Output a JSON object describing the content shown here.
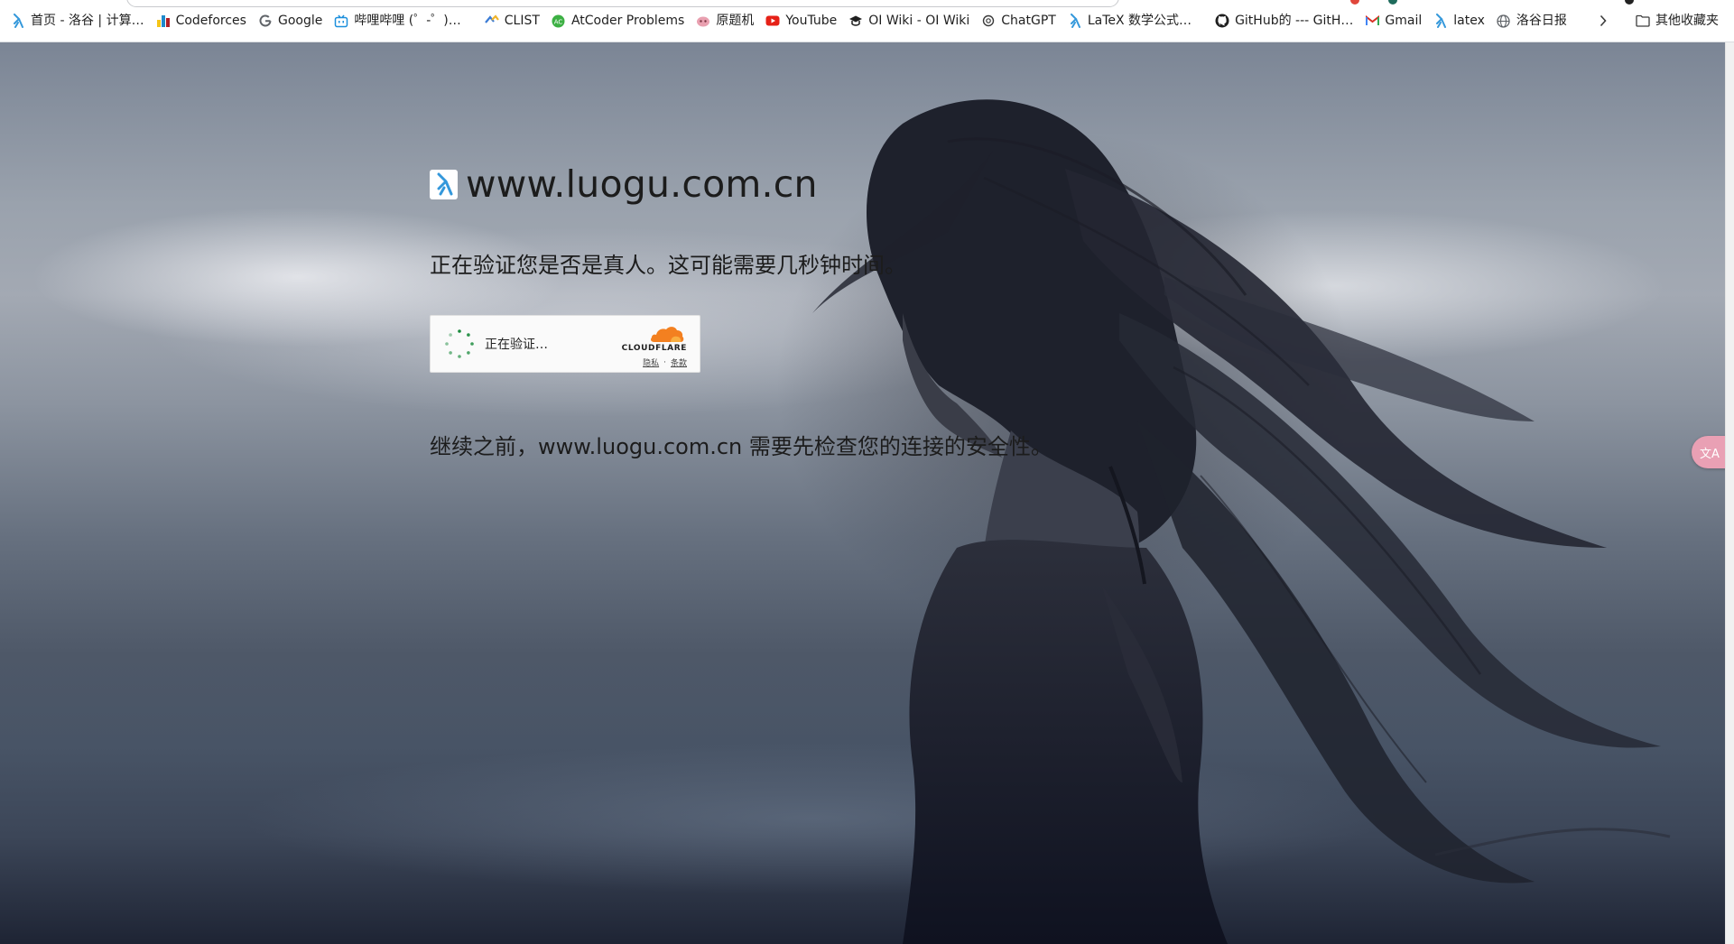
{
  "bookmarks_bar": {
    "items": [
      {
        "label": "首页 - 洛谷 | 计算…",
        "icon": "luogu-icon"
      },
      {
        "label": "Codeforces",
        "icon": "codeforces-icon"
      },
      {
        "label": "Google",
        "icon": "google-icon"
      },
      {
        "label": "哔哩哔哩 (゜-゜)…",
        "icon": "bilibili-icon"
      },
      {
        "label": "CLIST",
        "icon": "clist-icon"
      },
      {
        "label": "AtCoder Problems",
        "icon": "atcoder-icon"
      },
      {
        "label": "原题机",
        "icon": "yuantiji-icon"
      },
      {
        "label": "YouTube",
        "icon": "youtube-icon"
      },
      {
        "label": "OI Wiki - OI Wiki",
        "icon": "oiwiki-icon"
      },
      {
        "label": "ChatGPT",
        "icon": "chatgpt-icon"
      },
      {
        "label": "LaTeX 数学公式…",
        "icon": "luogu-icon"
      },
      {
        "label": "GitHub的 --- GitH…",
        "icon": "github-icon"
      },
      {
        "label": "Gmail",
        "icon": "gmail-icon"
      },
      {
        "label": "latex",
        "icon": "luogu-icon"
      },
      {
        "label": "洛谷日报",
        "icon": "globe-icon"
      }
    ],
    "other_bookmarks": "其他收藏夹"
  },
  "challenge": {
    "site": "www.luogu.com.cn",
    "verifying_message": "正在验证您是否是真人。这可能需要几秒钟时间。",
    "security_message": "继续之前，www.luogu.com.cn 需要先检查您的连接的安全性。"
  },
  "turnstile": {
    "status": "正在验证…",
    "brand": "CLOUDFLARE",
    "privacy_link": "隐私",
    "separator": "·",
    "terms_link": "条款"
  },
  "translate_button": "文A",
  "colors": {
    "cloudflare_orange": "#f38020",
    "spinner_green": "#1a8a3c",
    "luogu_blue": "#3498db"
  }
}
